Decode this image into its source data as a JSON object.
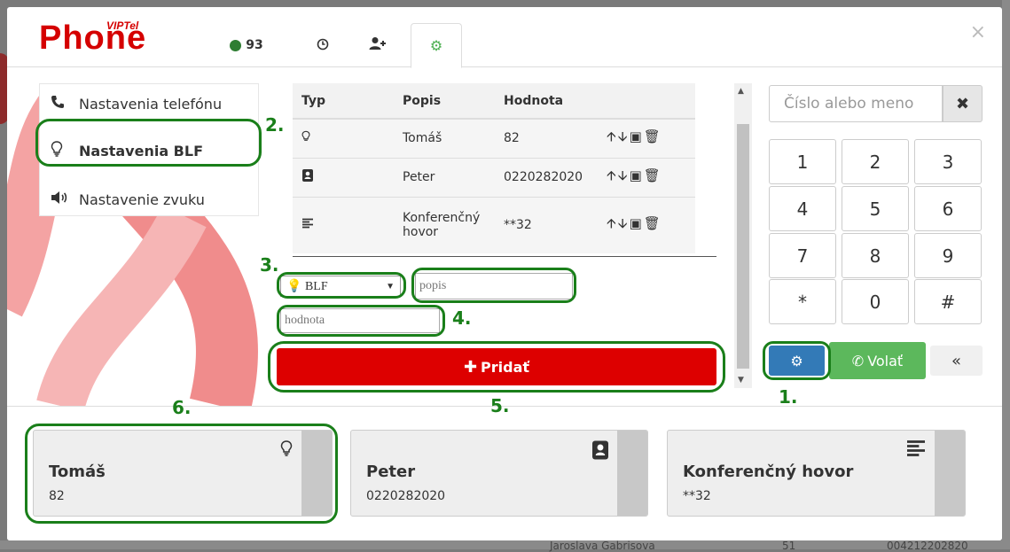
{
  "app": {
    "logo_text": "Phone",
    "logo_sup": "VIPTel",
    "status_count": "93"
  },
  "header_tabs": [
    {
      "icon": "status-dot-icon",
      "label": "93"
    },
    {
      "icon": "clock-icon",
      "label": "◷"
    },
    {
      "icon": "add-user-icon",
      "label": "➕"
    },
    {
      "icon": "gear-icon",
      "label": "⚙"
    }
  ],
  "close_label": "×",
  "settings_menu": {
    "items": [
      {
        "icon": "phone-icon",
        "label": "Nastavenia telefónu"
      },
      {
        "icon": "lightbulb-icon",
        "label": "Nastavenia BLF"
      },
      {
        "icon": "volume-icon",
        "label": "Nastavenie zvuku"
      }
    ]
  },
  "blf_table": {
    "headers": [
      "Typ",
      "Popis",
      "Hodnota"
    ],
    "rows": [
      {
        "type_icon": "lightbulb-icon",
        "popis": "Tomáš",
        "hodnota": "82"
      },
      {
        "type_icon": "contact-book-icon",
        "popis": "Peter",
        "hodnota": "0220282020"
      },
      {
        "type_icon": "lines-icon",
        "popis": "Konferenčný hovor",
        "hodnota": "**32"
      }
    ]
  },
  "form": {
    "type_select": "BLF",
    "popis_placeholder": "popis",
    "hodnota_placeholder": "hodnota",
    "add_button": "Pridať"
  },
  "dialer": {
    "input_placeholder": "Číslo alebo meno",
    "keys": [
      "1",
      "2",
      "3",
      "4",
      "5",
      "6",
      "7",
      "8",
      "9",
      "*",
      "0",
      "#"
    ],
    "call_label": "Volať",
    "collapse_label": "«"
  },
  "blf_cards": [
    {
      "name": "Tomáš",
      "number": "82",
      "icon": "lightbulb-icon"
    },
    {
      "name": "Peter",
      "number": "0220282020",
      "icon": "contact-book-icon"
    },
    {
      "name": "Konferenčný hovor",
      "number": "**32",
      "icon": "lines-icon"
    }
  ],
  "annotations": [
    "1.",
    "2.",
    "3.",
    "4.",
    "5.",
    "6."
  ],
  "background": {
    "bottom_text_left": "Jaroslava Gabrisova",
    "bottom_text_mid": "51",
    "bottom_text_right": "004212202820"
  },
  "colors": {
    "brand_red": "#dd0000",
    "annotation_green": "#1a7f1a",
    "call_green": "#5cb85c",
    "settings_blue": "#337ab7"
  }
}
